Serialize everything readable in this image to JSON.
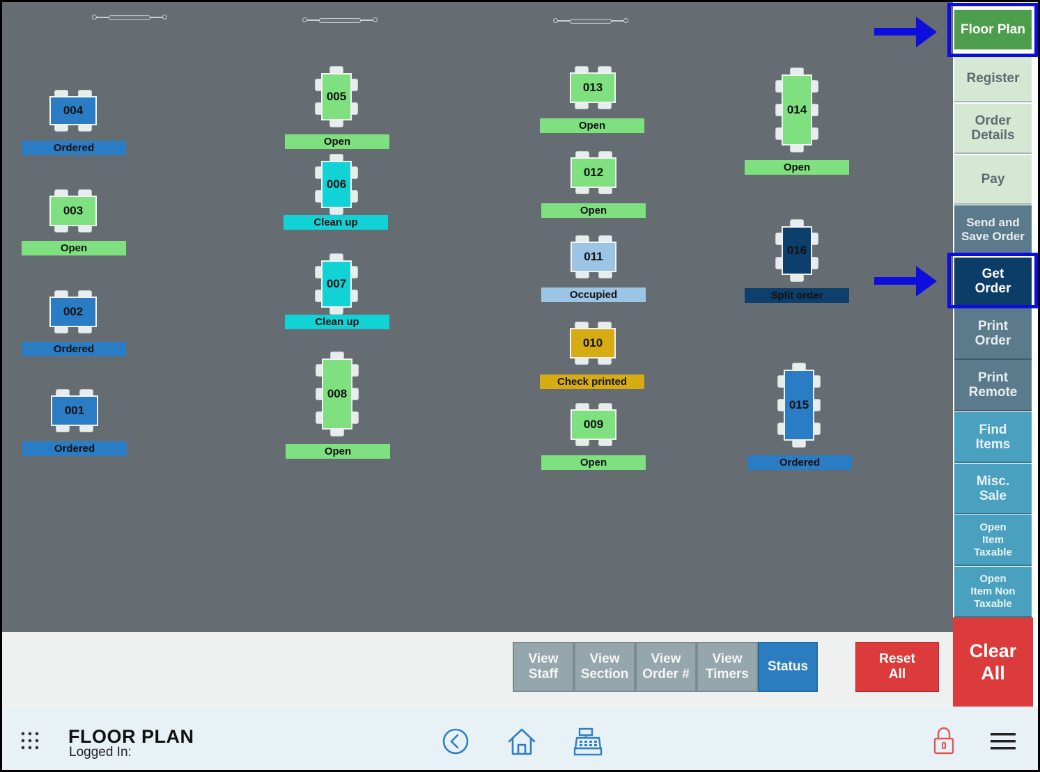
{
  "tables": [
    {
      "number": "004",
      "status": "Ordered"
    },
    {
      "number": "003",
      "status": "Open"
    },
    {
      "number": "002",
      "status": "Ordered"
    },
    {
      "number": "001",
      "status": "Ordered"
    },
    {
      "number": "005",
      "status": "Open"
    },
    {
      "number": "006",
      "status": "Clean up"
    },
    {
      "number": "007",
      "status": "Clean up"
    },
    {
      "number": "008",
      "status": "Open"
    },
    {
      "number": "013",
      "status": "Open"
    },
    {
      "number": "012",
      "status": "Open"
    },
    {
      "number": "011",
      "status": "Occupied"
    },
    {
      "number": "010",
      "status": "Check printed"
    },
    {
      "number": "009",
      "status": "Open"
    },
    {
      "number": "014",
      "status": "Open"
    },
    {
      "number": "016",
      "status": "Split order"
    },
    {
      "number": "015",
      "status": "Ordered"
    }
  ],
  "status_colors": {
    "Open": "#7ee07e",
    "Ordered": "#2a7dc4",
    "Clean up": "#11d3d6",
    "Occupied": "#9cc4e4",
    "Check printed": "#d7ac13",
    "Split order": "#0c3f6b"
  },
  "sidebar": {
    "floor_plan": "Floor Plan",
    "register": "Register",
    "order_details": "Order\nDetails",
    "pay": "Pay",
    "send_save": "Send and\nSave Order",
    "get_order": "Get\nOrder",
    "print_order": "Print\nOrder",
    "print_remote": "Print\nRemote",
    "find_items": "Find\nItems",
    "misc_sale": "Misc.\nSale",
    "open_item_taxable": "Open\nItem\nTaxable",
    "open_item_non_taxable": "Open\nItem Non\nTaxable",
    "clear_all": "Clear\nAll"
  },
  "actions": {
    "view_staff": "View\nStaff",
    "view_section": "View\nSection",
    "view_order": "View\nOrder #",
    "view_timers": "View\nTimers",
    "status": "Status",
    "reset_all": "Reset\nAll"
  },
  "bottom": {
    "title": "FLOOR PLAN",
    "logged_in": "Logged In:"
  },
  "colors": {
    "floor": "#656d72",
    "highlight": "#0d0dde",
    "floor_plan_active": "#4c9e4c",
    "get_order_active": "#0b3d66",
    "clear_red": "#dc3b3b"
  }
}
